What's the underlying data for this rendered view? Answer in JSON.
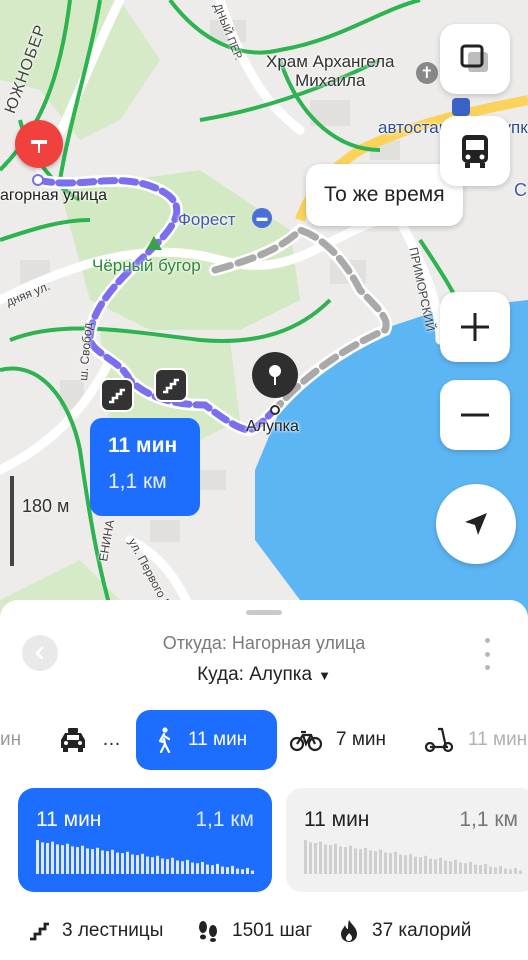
{
  "map": {
    "labels": {
      "south_coast": "ЮЖНОБЕР",
      "church": "Храм Архангела\nМихаила",
      "bus_station": "автостанция Алупка",
      "start_street": "агорная улица",
      "forest": "Форест",
      "hill": "Чёрный бугор",
      "alupka": "Алупка",
      "street_svobody": "ш. Свобод",
      "street_sadovaya": "дняя ул.",
      "street_primorskiy": "ПРИМОРСКИЙ",
      "street_pervogo": "ул. Первого М",
      "street_lenina": "ЕНИНА",
      "street_dny": "ДНЫЙ ПЕР.",
      "edge_c": "С"
    },
    "same_time_label": "То же время",
    "route_bubble": {
      "time": "11 мин",
      "distance": "1,1 км"
    },
    "scale_label": "180 м",
    "buttons": [
      "layers-icon",
      "bus-icon",
      "zoom-in-icon",
      "zoom-out-icon",
      "locate-icon"
    ],
    "colors": {
      "water": "#5db6f4",
      "road": "#ffffff",
      "main_road": "#fcd35a",
      "green_road": "#28b44a",
      "park": "#cfe6c0",
      "route": "#7b6ff0",
      "alt_route": "#a9a9a9"
    }
  },
  "panel": {
    "from": "Откуда: Нагорная улица",
    "to": "Куда: Алупка",
    "to_arrow": "▼",
    "modes": [
      {
        "name": "taxi",
        "label": "…",
        "prefix": "ин",
        "icon": "taxi-icon"
      },
      {
        "name": "walk",
        "label": "11 мин",
        "icon": "pedestrian-icon",
        "active": true
      },
      {
        "name": "bike",
        "label": "7 мин",
        "icon": "bicycle-icon"
      },
      {
        "name": "scooter",
        "label": "11 мин",
        "icon": "scooter-icon"
      }
    ],
    "routes": [
      {
        "time": "11 мин",
        "distance": "1,1 км",
        "selected": true
      },
      {
        "time": "11 мин",
        "distance": "1,1 км",
        "selected": false
      }
    ],
    "stats": {
      "stairs": "3 лестницы",
      "steps": "1501 шаг",
      "calories": "37 калорий"
    },
    "accent": "#1d6dff"
  }
}
